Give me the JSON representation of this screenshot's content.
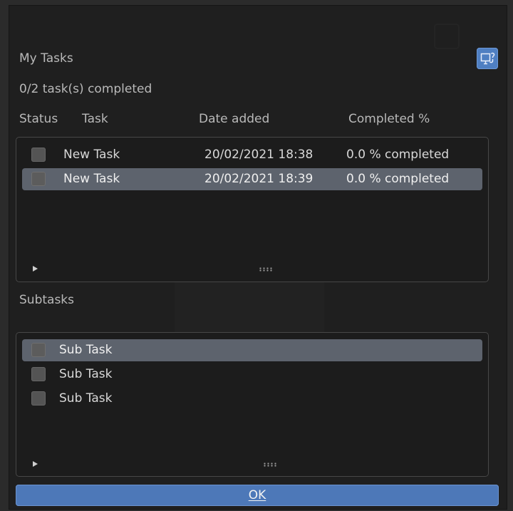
{
  "panel": {
    "title": "My Tasks",
    "summary": "0/2 task(s) completed",
    "columns": {
      "status": "Status",
      "task": "Task",
      "date": "Date added",
      "completed": "Completed %"
    }
  },
  "tasks": [
    {
      "name": "New Task",
      "date": "20/02/2021 18:38",
      "completed": "0.0 % completed",
      "checked": false,
      "selected": false
    },
    {
      "name": "New Task",
      "date": "20/02/2021 18:39",
      "completed": "0.0 % completed",
      "checked": false,
      "selected": true
    }
  ],
  "subtasks": {
    "title": "Subtasks",
    "items": [
      {
        "name": "Sub Task",
        "checked": false,
        "selected": true
      },
      {
        "name": "Sub Task",
        "checked": false,
        "selected": false
      },
      {
        "name": "Sub Task",
        "checked": false,
        "selected": false
      }
    ]
  },
  "footer": {
    "ok_label": "OK"
  },
  "icons": {
    "corner_button": "linked-display-icon",
    "expand": "triangle-right-icon",
    "grip": "resize-grip-icon"
  },
  "colors": {
    "accent": "#4d78b8",
    "selected_row": "#5d636d",
    "background": "#1f1f1f",
    "text": "#b9b9b9"
  }
}
